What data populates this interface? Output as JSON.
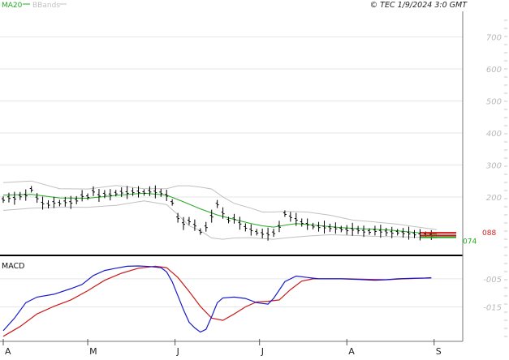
{
  "header": {
    "legend": [
      {
        "label": "MA20",
        "color": "#22aa22"
      },
      {
        "label": "BBands",
        "color": "#c0c0c0"
      }
    ],
    "copyright": "© TEC 1/9/2024 3:0 GMT"
  },
  "colors": {
    "price_bar": "#000000",
    "ma20": "#22aa22",
    "bbands": "#c0c0c0",
    "macd": "#1a1acc",
    "signal": "#cc1a1a",
    "grid": "#e6e6e6"
  },
  "chart_data": [
    {
      "type": "bar",
      "panel": "price",
      "ylim": [
        20,
        780
      ],
      "y_ticks": [
        200,
        300,
        400,
        500,
        600,
        700
      ],
      "y_tick_labels": [
        "200",
        "300",
        "400",
        "500",
        "600",
        "700"
      ],
      "x_month_labels": [
        {
          "label": "A",
          "day": 0
        },
        {
          "label": "M",
          "day": 30
        },
        {
          "label": "J",
          "day": 61
        },
        {
          "label": "J",
          "day": 91
        },
        {
          "label": "A",
          "day": 122
        },
        {
          "label": "S",
          "day": 153
        }
      ],
      "xlim": [
        0,
        162
      ],
      "price_series": [
        [
          0,
          192
        ],
        [
          2,
          198
        ],
        [
          4,
          196
        ],
        [
          6,
          203
        ],
        [
          8,
          206
        ],
        [
          10,
          224
        ],
        [
          12,
          197
        ],
        [
          14,
          181
        ],
        [
          16,
          177
        ],
        [
          18,
          183
        ],
        [
          20,
          181
        ],
        [
          22,
          185
        ],
        [
          24,
          183
        ],
        [
          26,
          190
        ],
        [
          28,
          204
        ],
        [
          30,
          201
        ],
        [
          32,
          218
        ],
        [
          34,
          205
        ],
        [
          36,
          209
        ],
        [
          38,
          207
        ],
        [
          40,
          212
        ],
        [
          42,
          215
        ],
        [
          44,
          214
        ],
        [
          46,
          216
        ],
        [
          48,
          216
        ],
        [
          50,
          214
        ],
        [
          52,
          218
        ],
        [
          54,
          216
        ],
        [
          56,
          213
        ],
        [
          58,
          205
        ],
        [
          60,
          183
        ],
        [
          62,
          135
        ],
        [
          64,
          117
        ],
        [
          66,
          125
        ],
        [
          68,
          112
        ],
        [
          70,
          92
        ],
        [
          72,
          107
        ],
        [
          74,
          140
        ],
        [
          76,
          178
        ],
        [
          78,
          150
        ],
        [
          80,
          128
        ],
        [
          82,
          132
        ],
        [
          84,
          118
        ],
        [
          86,
          105
        ],
        [
          88,
          97
        ],
        [
          90,
          90
        ],
        [
          92,
          86
        ],
        [
          94,
          84
        ],
        [
          96,
          88
        ],
        [
          98,
          108
        ],
        [
          100,
          148
        ],
        [
          102,
          138
        ],
        [
          104,
          130
        ],
        [
          106,
          120
        ],
        [
          108,
          115
        ],
        [
          110,
          109
        ],
        [
          112,
          107
        ],
        [
          114,
          106
        ],
        [
          116,
          104
        ],
        [
          118,
          103
        ],
        [
          120,
          100
        ],
        [
          122,
          97
        ],
        [
          124,
          99
        ],
        [
          126,
          97
        ],
        [
          128,
          93
        ],
        [
          130,
          92
        ],
        [
          132,
          95
        ],
        [
          134,
          93
        ],
        [
          136,
          91
        ],
        [
          138,
          89
        ],
        [
          140,
          90
        ],
        [
          142,
          88
        ],
        [
          144,
          87
        ],
        [
          146,
          84
        ],
        [
          148,
          82
        ],
        [
          150,
          82
        ],
        [
          152,
          81
        ]
      ],
      "ma20_series": [
        [
          0,
          206
        ],
        [
          10,
          208
        ],
        [
          20,
          197
        ],
        [
          30,
          196
        ],
        [
          40,
          205
        ],
        [
          50,
          212
        ],
        [
          58,
          206
        ],
        [
          64,
          185
        ],
        [
          70,
          163
        ],
        [
          76,
          144
        ],
        [
          82,
          130
        ],
        [
          88,
          117
        ],
        [
          92,
          110
        ],
        [
          96,
          106
        ],
        [
          100,
          112
        ],
        [
          104,
          117
        ],
        [
          108,
          114
        ],
        [
          114,
          109
        ],
        [
          120,
          104
        ],
        [
          126,
          101
        ],
        [
          132,
          99
        ],
        [
          138,
          96
        ],
        [
          144,
          91
        ],
        [
          150,
          86
        ],
        [
          154,
          84
        ]
      ],
      "bband_upper": [
        [
          0,
          245
        ],
        [
          10,
          250
        ],
        [
          20,
          226
        ],
        [
          30,
          225
        ],
        [
          40,
          236
        ],
        [
          50,
          226
        ],
        [
          58,
          226
        ],
        [
          62,
          235
        ],
        [
          66,
          235
        ],
        [
          70,
          231
        ],
        [
          74,
          225
        ],
        [
          78,
          200
        ],
        [
          82,
          180
        ],
        [
          88,
          165
        ],
        [
          92,
          153
        ],
        [
          96,
          153
        ],
        [
          100,
          155
        ],
        [
          108,
          153
        ],
        [
          116,
          143
        ],
        [
          124,
          128
        ],
        [
          132,
          122
        ],
        [
          140,
          115
        ],
        [
          148,
          105
        ],
        [
          154,
          98
        ]
      ],
      "bband_lower": [
        [
          0,
          158
        ],
        [
          10,
          165
        ],
        [
          20,
          168
        ],
        [
          30,
          168
        ],
        [
          40,
          174
        ],
        [
          50,
          188
        ],
        [
          58,
          176
        ],
        [
          62,
          145
        ],
        [
          66,
          110
        ],
        [
          70,
          95
        ],
        [
          74,
          72
        ],
        [
          78,
          68
        ],
        [
          82,
          72
        ],
        [
          88,
          73
        ],
        [
          92,
          70
        ],
        [
          96,
          68
        ],
        [
          100,
          72
        ],
        [
          108,
          78
        ],
        [
          116,
          82
        ],
        [
          124,
          80
        ],
        [
          132,
          77
        ],
        [
          140,
          76
        ],
        [
          148,
          74
        ],
        [
          154,
          72
        ]
      ],
      "last_markers": [
        {
          "value": 88,
          "color": "#cc1a1a",
          "label": "088"
        },
        {
          "value": 80,
          "color": "#cc1a1a",
          "label": ""
        },
        {
          "value": 74,
          "color": "#22aa22",
          "label": "074"
        }
      ]
    },
    {
      "type": "line",
      "panel": "macd",
      "title": "MACD",
      "ylim": [
        -0.27,
        0.025
      ],
      "y_ticks": [
        -0.05,
        -0.15
      ],
      "y_tick_labels": [
        "-005",
        "-015"
      ],
      "macd_series": [
        [
          0,
          -0.235
        ],
        [
          4,
          -0.19
        ],
        [
          8,
          -0.135
        ],
        [
          12,
          -0.115
        ],
        [
          18,
          -0.105
        ],
        [
          24,
          -0.085
        ],
        [
          28,
          -0.07
        ],
        [
          32,
          -0.038
        ],
        [
          36,
          -0.02
        ],
        [
          40,
          -0.012
        ],
        [
          44,
          -0.005
        ],
        [
          48,
          -0.004
        ],
        [
          52,
          -0.006
        ],
        [
          56,
          -0.01
        ],
        [
          58,
          -0.025
        ],
        [
          60,
          -0.06
        ],
        [
          62,
          -0.11
        ],
        [
          64,
          -0.16
        ],
        [
          66,
          -0.205
        ],
        [
          68,
          -0.225
        ],
        [
          70,
          -0.24
        ],
        [
          72,
          -0.23
        ],
        [
          74,
          -0.185
        ],
        [
          76,
          -0.135
        ],
        [
          78,
          -0.118
        ],
        [
          82,
          -0.115
        ],
        [
          86,
          -0.12
        ],
        [
          90,
          -0.135
        ],
        [
          94,
          -0.14
        ],
        [
          96,
          -0.12
        ],
        [
          100,
          -0.06
        ],
        [
          104,
          -0.04
        ],
        [
          108,
          -0.045
        ],
        [
          112,
          -0.05
        ],
        [
          116,
          -0.05
        ],
        [
          120,
          -0.05
        ],
        [
          126,
          -0.052
        ],
        [
          132,
          -0.055
        ],
        [
          136,
          -0.053
        ],
        [
          140,
          -0.05
        ],
        [
          146,
          -0.048
        ],
        [
          150,
          -0.047
        ],
        [
          152,
          -0.046
        ]
      ],
      "signal_series": [
        [
          0,
          -0.255
        ],
        [
          6,
          -0.22
        ],
        [
          12,
          -0.175
        ],
        [
          18,
          -0.148
        ],
        [
          24,
          -0.125
        ],
        [
          30,
          -0.092
        ],
        [
          36,
          -0.055
        ],
        [
          42,
          -0.03
        ],
        [
          48,
          -0.012
        ],
        [
          54,
          -0.005
        ],
        [
          58,
          -0.01
        ],
        [
          62,
          -0.045
        ],
        [
          66,
          -0.095
        ],
        [
          70,
          -0.148
        ],
        [
          74,
          -0.19
        ],
        [
          78,
          -0.198
        ],
        [
          82,
          -0.175
        ],
        [
          86,
          -0.15
        ],
        [
          90,
          -0.132
        ],
        [
          94,
          -0.13
        ],
        [
          98,
          -0.125
        ],
        [
          102,
          -0.088
        ],
        [
          106,
          -0.058
        ],
        [
          110,
          -0.05
        ],
        [
          116,
          -0.05
        ],
        [
          122,
          -0.05
        ],
        [
          130,
          -0.052
        ],
        [
          136,
          -0.053
        ],
        [
          142,
          -0.05
        ],
        [
          148,
          -0.048
        ],
        [
          152,
          -0.047
        ]
      ]
    }
  ]
}
